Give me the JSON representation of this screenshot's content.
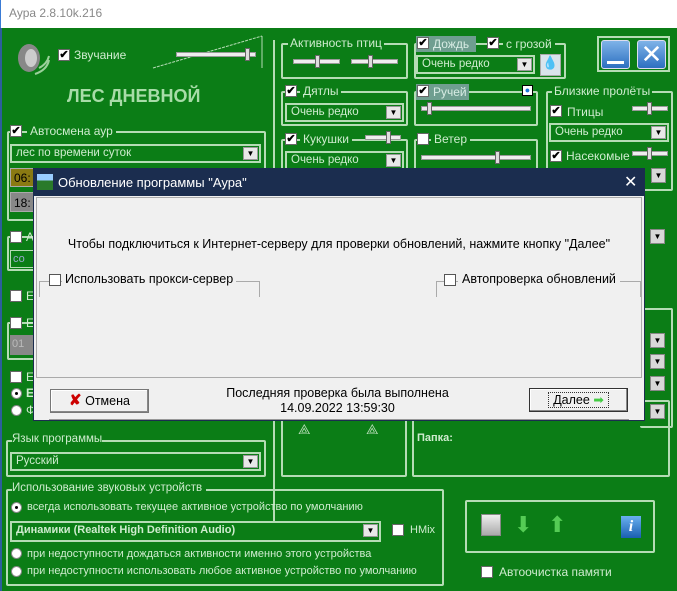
{
  "window": {
    "title": "Аура 2.8.10k.216"
  },
  "header": {
    "sound_label": "Звучание",
    "sound_checked": true,
    "volume_percent": 95,
    "scene_title": "ЛЕС ДНЕВНОЙ"
  },
  "autochange": {
    "label": "Автосмена аур",
    "checked": true,
    "mode": "лес по времени суток",
    "time1": "06:",
    "time2": "18:"
  },
  "birds": {
    "label": "Активность птиц",
    "slider1_percent": 45,
    "slider2_percent": 35
  },
  "woodpeckers": {
    "label": "Дятлы",
    "checked": true,
    "frequency": "Очень редко"
  },
  "cuckoos": {
    "label": "Кукушки",
    "checked": true,
    "frequency": "Очень редко",
    "slider_percent": 60
  },
  "rain": {
    "label": "Дождь",
    "checked": true,
    "thunder_label": "с грозой",
    "thunder_checked": true,
    "frequency": "Очень редко"
  },
  "stream": {
    "label": "Ручей",
    "checked": true,
    "slider_percent": 5
  },
  "wind": {
    "label": "Ветер",
    "checked": false,
    "slider_percent": 68
  },
  "flybys": {
    "label": "Близкие пролёты",
    "birds_label": "Птицы",
    "birds_checked": true,
    "birds_frequency": "Очень редко",
    "insects_label": "Насекомые",
    "insects_checked": true
  },
  "partial": {
    "a": "А",
    "co": "со",
    "e1": "Е",
    "e2": "Е",
    "v01": "01",
    "e3": "Е",
    "e4": "Е",
    "f": "Ф"
  },
  "folder": {
    "label": "Папка:"
  },
  "language": {
    "label": "Язык программы",
    "value": "Русский"
  },
  "devices": {
    "label": "Использование звуковых устройств",
    "opt1": "всегда использовать текущее активное устройство по умолчанию",
    "device": "Динамики (Realtek High Definition Audio)",
    "hmix": "HMix",
    "opt2": "при недоступности дождаться активности именно этого устройства",
    "opt3": "при недоступности использовать любое активное устройство по умолчанию",
    "selected": 1
  },
  "autoclean": {
    "label": "Автоочистка памяти",
    "checked": false
  },
  "dialog": {
    "title": "Обновление программы \"Аура\"",
    "message": "Чтобы подключиться к Интернет-серверу для проверки обновлений, нажмите кнопку \"Далее\"",
    "proxy_label": "Использовать прокси-сервер",
    "autocheck_label": "Автопроверка обновлений",
    "cancel": "Отмена",
    "last_check": "Последняя проверка была выполнена",
    "last_check_time": "14.09.2022 13:59:30",
    "next": "Далее"
  },
  "colors": {
    "background": "#0b7d16",
    "dialog_header": "#1b2d4f",
    "text": "#cfeccf"
  }
}
